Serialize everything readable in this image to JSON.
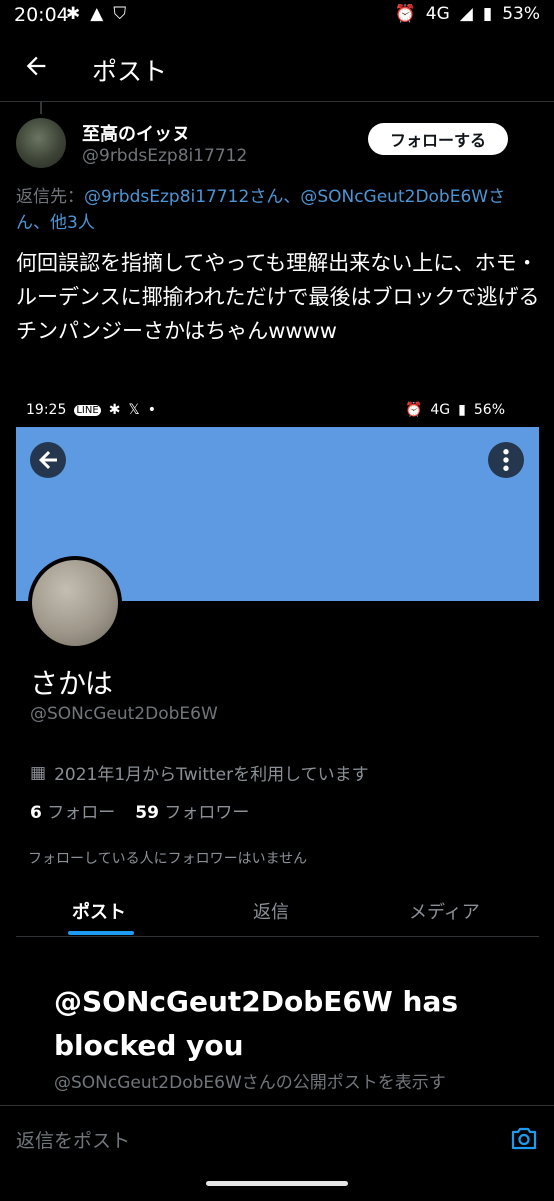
{
  "status_bar": {
    "time": "20:04",
    "left_icons": [
      "bluetooth-icon",
      "warning-icon",
      "shield-icon"
    ],
    "network": "4G",
    "battery": "53%"
  },
  "header": {
    "title": "ポスト"
  },
  "post": {
    "author_name": "至高のイッヌ",
    "author_handle": "@9rbdsEzp8i17712",
    "follow_label": "フォローする",
    "reply_to_prefix": "返信先：",
    "reply_to_mentions": "@9rbdsEzp8i17712さん、@SONcGeut2DobE6Wさ",
    "reply_to_line2": "ん、他3人",
    "text": "何回誤認を指摘してやっても理解出来ない上に、ホモ・ルーデンスに揶揄われただけで最後はブロックで逃げるチンパンジーさかはちゃんwwww"
  },
  "embedded_screenshot": {
    "status_time": "19:25",
    "status_network": "4G",
    "status_battery": "56%",
    "profile_name": "さかは",
    "profile_handle": "@SONcGeut2DobE6W",
    "joined": "2021年1月からTwitterを利用しています",
    "following_count": "6",
    "following_label": "フォロー",
    "followers_count": "59",
    "followers_label": "フォロワー",
    "known_followers": "フォローしている人にフォロワーはいません",
    "tabs": [
      "ポスト",
      "返信",
      "メディア"
    ],
    "blocked_title": "@SONcGeut2DobE6W has blocked you",
    "blocked_sub": "@SONcGeut2DobE6Wさんの公開ポストを表示す"
  },
  "reply_bar": {
    "placeholder": "返信をポスト"
  },
  "colors": {
    "accent": "#1d9bf0",
    "mention": "#4b95d6",
    "banner": "#5d9ae2"
  }
}
